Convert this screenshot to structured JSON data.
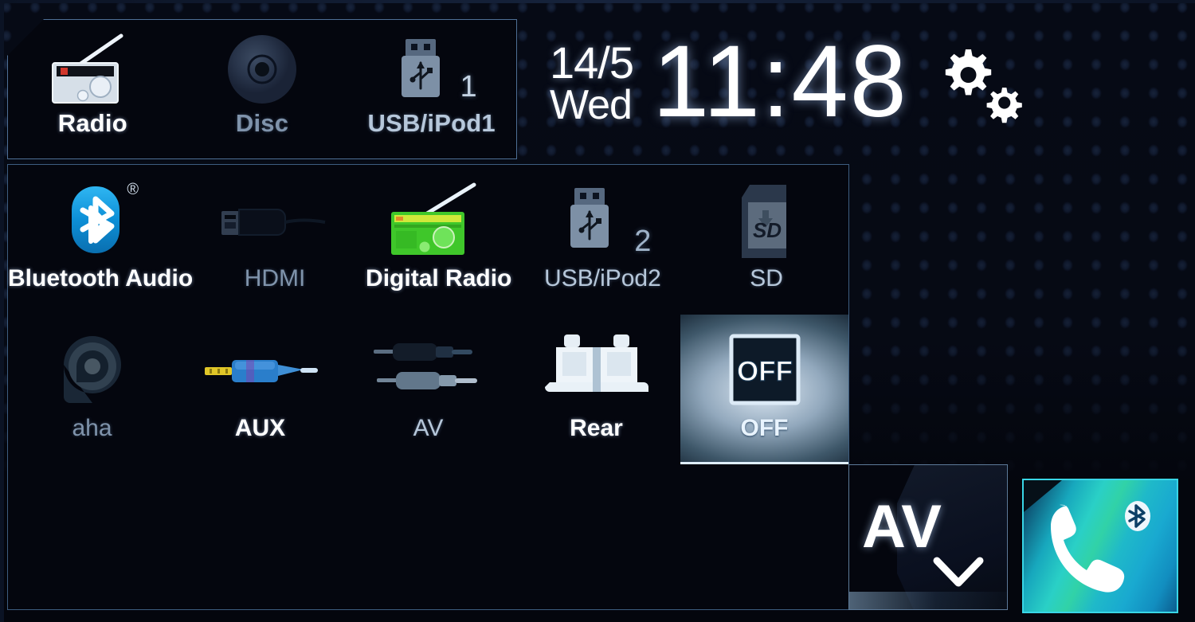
{
  "header": {
    "date": "14/5",
    "weekday": "Wed",
    "time": "11:48",
    "settings_icon": "gears-icon"
  },
  "top_sources": [
    {
      "label": "Radio",
      "icon": "radio-icon",
      "state": "active"
    },
    {
      "label": "Disc",
      "icon": "disc-icon",
      "state": "dim"
    },
    {
      "label": "USB/iPod1",
      "icon": "usb-icon",
      "state": "mid",
      "badge": "1"
    }
  ],
  "source_grid": {
    "row1": [
      {
        "label": "Bluetooth Audio",
        "icon": "bluetooth-icon",
        "state": "active",
        "mark": "®"
      },
      {
        "label": "HDMI",
        "icon": "hdmi-cable-icon",
        "state": "dim"
      },
      {
        "label": "Digital Radio",
        "icon": "digital-radio-icon",
        "state": "active"
      },
      {
        "label": "USB/iPod2",
        "icon": "usb-icon",
        "state": "mid",
        "badge": "2"
      },
      {
        "label": "SD",
        "icon": "sd-card-icon",
        "state": "mid"
      }
    ],
    "row2": [
      {
        "label": "aha",
        "icon": "aha-icon",
        "state": "dim"
      },
      {
        "label": "AUX",
        "icon": "aux-plug-icon",
        "state": "active"
      },
      {
        "label": "AV",
        "icon": "av-rca-icon",
        "state": "mid"
      },
      {
        "label": "Rear",
        "icon": "rear-seat-icon",
        "state": "active"
      },
      {
        "label": "OFF",
        "icon": "off-tile-icon",
        "state": "selected",
        "tile_text": "OFF"
      }
    ]
  },
  "bottom_bar": {
    "av_button": {
      "label": "AV",
      "icon": "chevron-down-icon"
    },
    "phone_button": {
      "icon": "phone-handset-icon",
      "badge_icon": "bluetooth-badge-icon"
    }
  },
  "colors": {
    "accent_cyan": "#39d6e6",
    "bluetooth_blue": "#1a9fe0",
    "digital_radio_green": "#3fc72a",
    "panel_border": "#3d5d80",
    "label_active": "#ffffff",
    "label_dim": "#7f93ab"
  }
}
